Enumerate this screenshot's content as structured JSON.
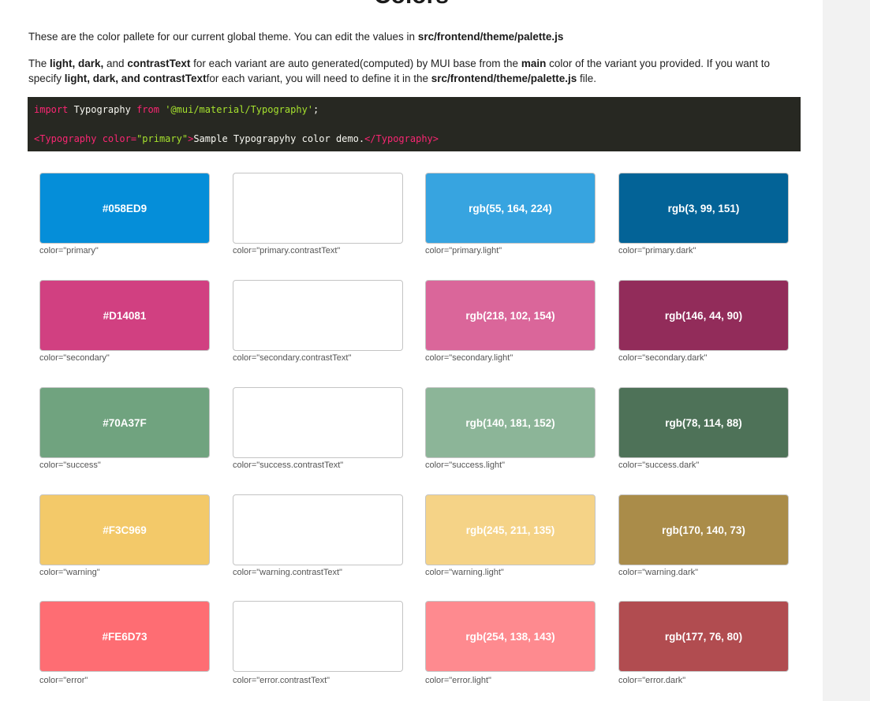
{
  "page_title": "Colors",
  "intro": {
    "text": "These are the color pallete for our current global theme. You can edit the values in ",
    "path": "src/frontend/theme/palette.js"
  },
  "detail": {
    "t1": "The ",
    "b1": "light, dark,",
    "t2": " and ",
    "b2": "contrastText",
    "t3": " for each variant are auto generated(computed) by MUI base from the ",
    "b3": "main",
    "t4": " color of the variant you provided. If you want to specify ",
    "b4": "light, dark, and contrastText",
    "t5": "for each variant, you will need to define it in the ",
    "b5": "src/frontend/theme/palette.js",
    "t6": " file."
  },
  "code": {
    "import_kw": "import",
    "import_name": " Typography ",
    "from_kw": "from",
    "module": " '@mui/material/Typography'",
    "semicolon": ";",
    "open_tag": "<Typography",
    "attr_name": " color=",
    "attr_value": "\"primary\"",
    "open_close": ">",
    "inner_text": "Sample Typograpyhy color demo.",
    "close_tag": "</Typography>"
  },
  "swatches": [
    [
      {
        "label": "#058ED9",
        "bg": "#058ED9",
        "fg": "#ffffff",
        "caption": "color=\"primary\""
      },
      {
        "label": "",
        "bg": "#ffffff",
        "fg": "#ffffff",
        "caption": "color=\"primary.contrastText\""
      },
      {
        "label": "rgb(55, 164, 224)",
        "bg": "#37A4E0",
        "fg": "#ffffff",
        "caption": "color=\"primary.light\""
      },
      {
        "label": "rgb(3, 99, 151)",
        "bg": "#036397",
        "fg": "#ffffff",
        "caption": "color=\"primary.dark\""
      }
    ],
    [
      {
        "label": "#D14081",
        "bg": "#D14081",
        "fg": "#ffffff",
        "caption": "color=\"secondary\""
      },
      {
        "label": "",
        "bg": "#ffffff",
        "fg": "#ffffff",
        "caption": "color=\"secondary.contrastText\""
      },
      {
        "label": "rgb(218, 102, 154)",
        "bg": "#DA669A",
        "fg": "#ffffff",
        "caption": "color=\"secondary.light\""
      },
      {
        "label": "rgb(146, 44, 90)",
        "bg": "#922C5A",
        "fg": "#ffffff",
        "caption": "color=\"secondary.dark\""
      }
    ],
    [
      {
        "label": "#70A37F",
        "bg": "#70A37F",
        "fg": "#ffffff",
        "caption": "color=\"success\""
      },
      {
        "label": "",
        "bg": "#ffffff",
        "fg": "#ffffff",
        "caption": "color=\"success.contrastText\""
      },
      {
        "label": "rgb(140, 181, 152)",
        "bg": "#8CB598",
        "fg": "#ffffff",
        "caption": "color=\"success.light\""
      },
      {
        "label": "rgb(78, 114, 88)",
        "bg": "#4E7258",
        "fg": "#ffffff",
        "caption": "color=\"success.dark\""
      }
    ],
    [
      {
        "label": "#F3C969",
        "bg": "#F3C969",
        "fg": "#ffffff",
        "caption": "color=\"warning\""
      },
      {
        "label": "",
        "bg": "#ffffff",
        "fg": "#ffffff",
        "caption": "color=\"warning.contrastText\""
      },
      {
        "label": "rgb(245, 211, 135)",
        "bg": "#F5D387",
        "fg": "#ffffff",
        "caption": "color=\"warning.light\""
      },
      {
        "label": "rgb(170, 140, 73)",
        "bg": "#AA8C49",
        "fg": "#ffffff",
        "caption": "color=\"warning.dark\""
      }
    ],
    [
      {
        "label": "#FE6D73",
        "bg": "#FE6D73",
        "fg": "#ffffff",
        "caption": "color=\"error\""
      },
      {
        "label": "",
        "bg": "#ffffff",
        "fg": "#ffffff",
        "caption": "color=\"error.contrastText\""
      },
      {
        "label": "rgb(254, 138, 143)",
        "bg": "#FE8A8F",
        "fg": "#ffffff",
        "caption": "color=\"error.light\""
      },
      {
        "label": "rgb(177, 76, 80)",
        "bg": "#B14C50",
        "fg": "#ffffff",
        "caption": "color=\"error.dark\""
      }
    ]
  ]
}
